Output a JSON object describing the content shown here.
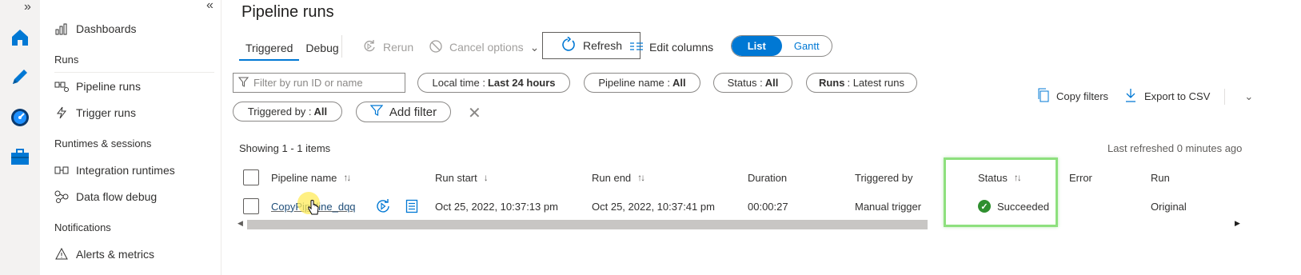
{
  "rail": {
    "expand_label": "»"
  },
  "sidenav": {
    "collapse_label": "«",
    "dashboards": "Dashboards",
    "runs_header": "Runs",
    "pipeline_runs": "Pipeline runs",
    "trigger_runs": "Trigger runs",
    "runtimes_header": "Runtimes & sessions",
    "integration_runtimes": "Integration runtimes",
    "data_flow_debug": "Data flow debug",
    "notifications_header": "Notifications",
    "alerts_metrics": "Alerts & metrics"
  },
  "page": {
    "title": "Pipeline runs"
  },
  "tabs": [
    {
      "label": "Triggered",
      "active": true
    },
    {
      "label": "Debug",
      "active": false
    }
  ],
  "toolbar": {
    "rerun": "Rerun",
    "cancel_options": "Cancel options",
    "refresh": "Refresh",
    "edit_columns": "Edit columns",
    "view_list": "List",
    "view_gantt": "Gantt"
  },
  "filters": {
    "search_placeholder": "Filter by run ID or name",
    "local_time_label": "Local time :",
    "local_time_value": "Last 24 hours",
    "pipeline_name_label": "Pipeline name :",
    "pipeline_name_value": "All",
    "status_label": "Status :",
    "status_value": "All",
    "runs_label": "Runs",
    "runs_value": ": Latest runs",
    "triggered_by_label": "Triggered by :",
    "triggered_by_value": "All",
    "add_filter": "Add filter",
    "copy_filters": "Copy filters",
    "export_csv": "Export to CSV"
  },
  "grid": {
    "showing": "Showing 1 - 1 items",
    "last_refreshed": "Last refreshed 0 minutes ago",
    "columns": [
      "Pipeline name",
      "Run start",
      "Run end",
      "Duration",
      "Triggered by",
      "Status",
      "Error",
      "Run"
    ],
    "rows": [
      {
        "pipeline_name": "CopyPipeline_dqq",
        "run_start": "Oct 25, 2022, 10:37:13 pm",
        "run_end": "Oct 25, 2022, 10:37:41 pm",
        "duration": "00:00:27",
        "triggered_by": "Manual trigger",
        "status": "Succeeded",
        "error": "",
        "run": "Original"
      }
    ]
  },
  "colors": {
    "accent": "#0078d4",
    "success": "#2f8f2f",
    "highlight": "#8ee07e"
  }
}
